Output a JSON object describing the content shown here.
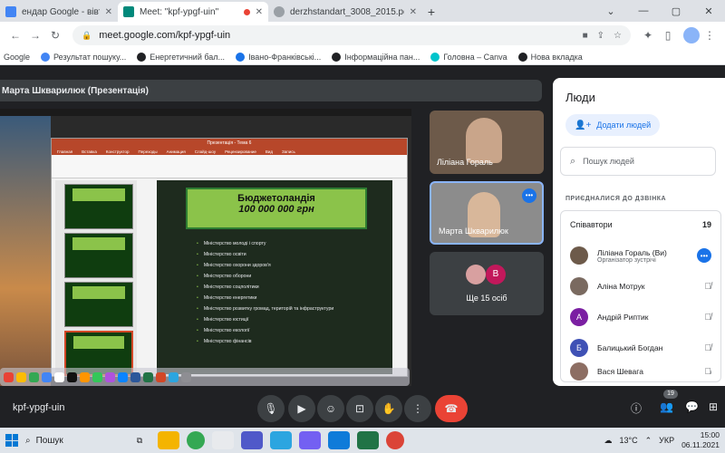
{
  "browser": {
    "tabs": [
      {
        "title": "ендар Google - вівторок, 7",
        "color": "#4285f4",
        "active": false
      },
      {
        "title": "Meet: \"kpf-ypgf-uin\"",
        "color": "#00897b",
        "active": true
      },
      {
        "title": "derzhstandart_3008_2015.pdf",
        "color": "#5f6368",
        "active": false
      }
    ],
    "new_tab": "+",
    "url": "meet.google.com/kpf-ypgf-uin",
    "bookmarks": [
      {
        "label": "Google",
        "color": ""
      },
      {
        "label": "Результат пошуку...",
        "color": "#4285f4"
      },
      {
        "label": "Енергетичний бал...",
        "color": "#202124"
      },
      {
        "label": "Івано-Франківські...",
        "color": "#1a73e8"
      },
      {
        "label": "Інформаційна пан...",
        "color": "#202124"
      },
      {
        "label": "Головна – Canva",
        "color": "#00c4cc"
      },
      {
        "label": "Нова вкладка",
        "color": "#202124"
      }
    ]
  },
  "meet": {
    "presenter_label": "Марта Шкварилюк (Презентація)",
    "tiles": [
      {
        "name": "Ліліана Гораль",
        "bg": "#6d5a4a"
      },
      {
        "name": "Марта Шкварилюк",
        "bg": "#8c8c8c"
      },
      {
        "name": "Ще 15 осіб",
        "bg": "#3c4043",
        "initial": "B"
      }
    ],
    "meeting_code": "kpf-ypgf-uin",
    "participant_badge": "19"
  },
  "slide": {
    "window_title": "Презентація - Тема 6",
    "tabs": [
      "Главная",
      "Вставка",
      "Конструктор",
      "Переходы",
      "Анимация",
      "Слайд-шоу",
      "Рецензирование",
      "Вид",
      "Запись"
    ],
    "heading_line1": "Бюджетоландія",
    "heading_line2": "100 000 000 грн",
    "items": [
      "Міністерство молоді і спорту",
      "Міністерство освіти",
      "Міністерство охорони здоров'я",
      "Міністерство оборони",
      "Міністерство соцполітики",
      "Міністерство енергетики",
      "Міністерство розвитку громад, територій та інфраструктури",
      "Міністерство юстиції",
      "Міністерство екології",
      "Міністерство фінансів"
    ]
  },
  "people": {
    "title": "Люди",
    "add_label": "Додати людей",
    "search_placeholder": "Пошук людей",
    "section_label": "ПРИЄДНАЛИСЯ ДО ДЗВІНКА",
    "group_label": "Співавтори",
    "group_count": "19",
    "members": [
      {
        "name": "Ліліана Гораль (Ви)",
        "role": "Організатор зустрічі",
        "initial": "",
        "color": "#6d5a4a"
      },
      {
        "name": "Аліна Мотрук",
        "role": "",
        "initial": "",
        "color": "#7a6a60"
      },
      {
        "name": "Андрій Риптик",
        "role": "",
        "initial": "А",
        "color": "#7b1fa2"
      },
      {
        "name": "Балицький Богдан",
        "role": "",
        "initial": "Б",
        "color": "#3f51b5"
      },
      {
        "name": "Вася Шевага",
        "role": "",
        "initial": "",
        "color": "#8d6e63"
      }
    ]
  },
  "taskbar": {
    "search_label": "Пошук",
    "weather": "13°C",
    "lang": "УКР",
    "time": "15:00",
    "date": "06.11.2021"
  }
}
